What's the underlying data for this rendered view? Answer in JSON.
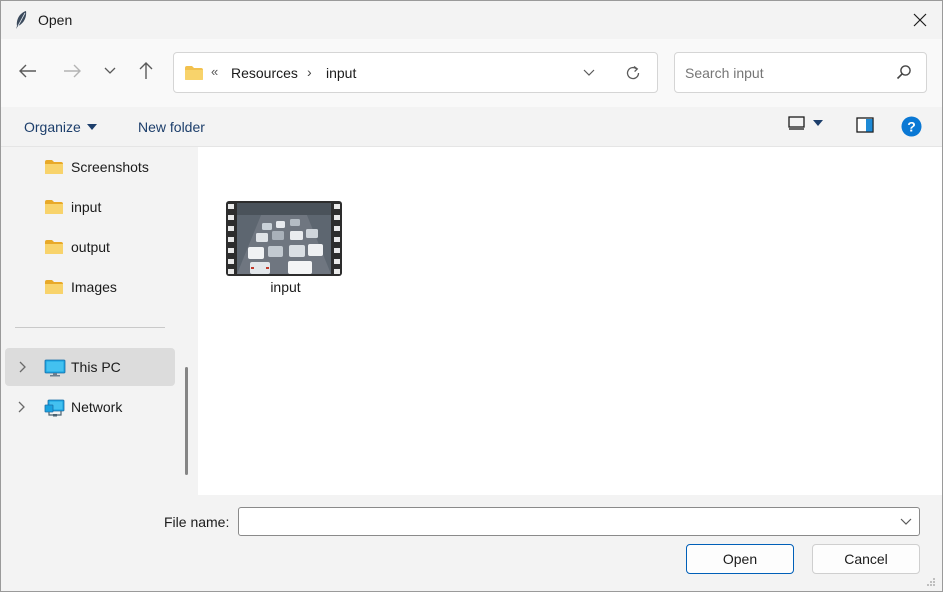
{
  "window": {
    "title": "Open",
    "icon": "feather-icon"
  },
  "address_bar": {
    "overflow_chevron": "«",
    "crumbs": [
      "Resources",
      "input"
    ],
    "separator": "›"
  },
  "search": {
    "placeholder": "Search input"
  },
  "command_bar": {
    "organize_label": "Organize",
    "new_folder_label": "New folder"
  },
  "nav_pane": {
    "quick_items": [
      {
        "label": "Screenshots",
        "icon": "folder-icon"
      },
      {
        "label": "input",
        "icon": "folder-icon"
      },
      {
        "label": "output",
        "icon": "folder-icon"
      },
      {
        "label": "Images",
        "icon": "folder-icon"
      }
    ],
    "locations": [
      {
        "label": "This PC",
        "icon": "monitor-icon",
        "selected": true
      },
      {
        "label": "Network",
        "icon": "network-icon",
        "selected": false
      }
    ]
  },
  "files": [
    {
      "name": "input",
      "type": "video",
      "thumbnail": "traffic-video-thumbnail"
    }
  ],
  "bottom": {
    "file_name_label": "File name:",
    "file_name_value": "",
    "open_label": "Open",
    "cancel_label": "Cancel"
  },
  "colors": {
    "accent": "#005fb8",
    "folder": "#f2c14e",
    "help": "#0a78d4",
    "link_text": "#1c3e6b"
  }
}
